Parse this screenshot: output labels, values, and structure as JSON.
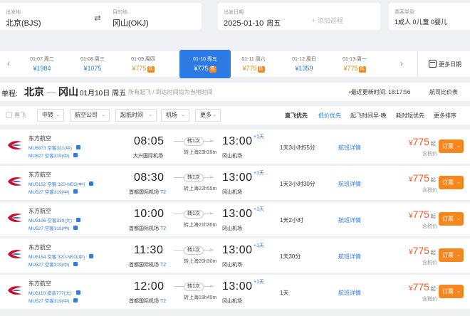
{
  "search": {
    "from_label": "出发地",
    "from_value": "北京(BJS)",
    "to_label": "目的地",
    "to_value": "冈山(OKJ)",
    "date_label": "出发日期",
    "date_value": "2025-01-10",
    "date_weekday": "周五",
    "add_return": "+ 添加返程",
    "pax_label": "乘客类型",
    "pax_value": "1成人  0儿童  0婴儿"
  },
  "dates": [
    {
      "date": "01-07 周二",
      "price": "¥1984",
      "low": false,
      "tag": ""
    },
    {
      "date": "01-08 周三",
      "price": "¥1075",
      "low": false,
      "tag": ""
    },
    {
      "date": "01-09 周四",
      "price": "¥775",
      "low": true,
      "tag": "低"
    },
    {
      "date": "01-10 周五",
      "price": "¥775",
      "low": true,
      "tag": "低",
      "active": true
    },
    {
      "date": "01-11 周六",
      "price": "¥775",
      "low": true,
      "tag": "低"
    },
    {
      "date": "01-12 周日",
      "price": "¥1359",
      "low": false,
      "tag": ""
    },
    {
      "date": "01-13 周一",
      "price": "¥775",
      "low": true,
      "tag": "低"
    }
  ],
  "more_dates": "更多日期",
  "title": {
    "prefix": "单程:",
    "from_city": "北京",
    "dash": "—",
    "to_city": "冈山",
    "date": "01月10日 周五",
    "note": "所有起飞 / 到达时间均为当地时间",
    "update": "•最近更新时间: 18:17:56",
    "compare": "航司比价表"
  },
  "filters": {
    "direct_label": "直飞",
    "transfer": "中转",
    "airline": "航空公司",
    "dep_time": "起抵时间",
    "airport": "机场",
    "more": "更多",
    "sort_direct": "直飞优先",
    "sort_low": "低价优先",
    "sort_dep": "起飞时间早-晚",
    "sort_dur": "耗时短优先",
    "sort_more": "更多排序"
  },
  "flights": [
    {
      "airline": "东方航空",
      "leg1": "MU6873 空客321(中)",
      "leg2": "MU527 空客319(中)",
      "dep": "08:05",
      "dep_ap": "大兴国际机场",
      "dep_term": "",
      "stops": "转1次",
      "via": "转上海23h35m",
      "arr": "13:00",
      "plus": "+1天",
      "arr_ap": "冈山机场",
      "dur": "1天3小时55分",
      "detail": "航班详情",
      "yen": "¥",
      "price": "775",
      "qi": "起",
      "tax": "含税价",
      "book": "订票"
    },
    {
      "airline": "东方航空",
      "leg1": "MU5152 空客 320-NEO(中)",
      "leg2": "MU527 空客319(中)",
      "dep": "08:30",
      "dep_ap": "首都国际机场",
      "dep_term": "T2",
      "stops": "转1次",
      "via": "转上海22h55m",
      "arr": "13:00",
      "plus": "+1天",
      "arr_ap": "冈山机场",
      "dur": "1天3小时30分",
      "detail": "航班详情",
      "yen": "¥",
      "price": "775",
      "qi": "起",
      "tax": "含税价",
      "book": "订票"
    },
    {
      "airline": "东方航空",
      "leg1": "MU5106 空客330(大)",
      "leg2": "MU527 空客319(中)",
      "dep": "10:00",
      "dep_ap": "首都国际机场",
      "dep_term": "T2",
      "stops": "转1次",
      "via": "转上海21h30m",
      "arr": "13:00",
      "plus": "+1天",
      "arr_ap": "冈山机场",
      "dur": "1天2小时",
      "detail": "航班详情",
      "yen": "¥",
      "price": "775",
      "qi": "起",
      "tax": "含税价",
      "book": "订票"
    },
    {
      "airline": "东方航空",
      "leg1": "MU5154 空客 320-NEO(中)",
      "leg2": "MU527 空客319(中)",
      "dep": "11:30",
      "dep_ap": "首都国际机场",
      "dep_term": "T2",
      "stops": "转1次",
      "via": "转上海20h30m",
      "arr": "13:00",
      "plus": "+1天",
      "arr_ap": "冈山机场",
      "dur": "1天30分",
      "detail": "航班详情",
      "yen": "¥",
      "price": "775",
      "qi": "起",
      "tax": "含税价",
      "book": "订票"
    },
    {
      "airline": "东方航空",
      "leg1": "MU5110 波音777(大)",
      "leg2": "MU527 空客319(中)",
      "dep": "12:00",
      "dep_ap": "首都国际机场",
      "dep_term": "T2",
      "stops": "转1次",
      "via": "转上海19h45m",
      "arr": "13:00",
      "plus": "+1天",
      "arr_ap": "冈山机场",
      "dur": "1天",
      "detail": "航班详情",
      "yen": "¥",
      "price": "775",
      "qi": "起",
      "tax": "含税价",
      "book": "订票"
    }
  ],
  "colors": {
    "accent": "#2f7be5",
    "price": "#f25a2a",
    "book": "#f5871f",
    "low_price": "#f08a22"
  }
}
